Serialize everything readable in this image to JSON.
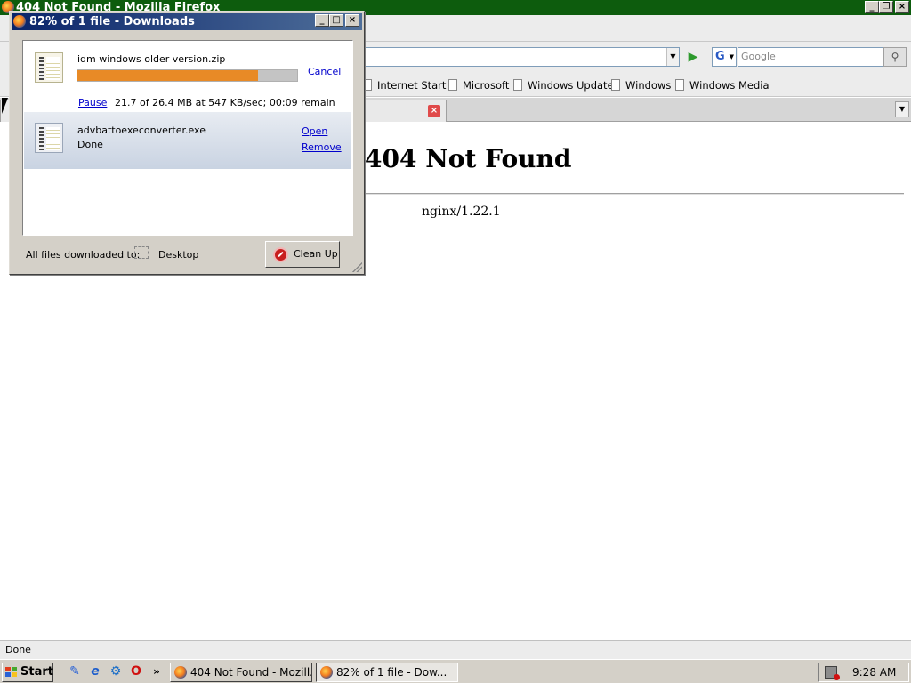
{
  "browser": {
    "window_title": "404 Not Found - Mozilla Firefox",
    "search_engine_letter": "G",
    "search_placeholder": "Google",
    "bookmarks": [
      "Internet Start",
      "Microsoft",
      "Windows Update",
      "Windows",
      "Windows Media"
    ],
    "page_heading": "404 Not Found",
    "page_server": "nginx/1.22.1",
    "status_text": "Done"
  },
  "downloads": {
    "window_title": "82% of 1 file - Downloads",
    "items": [
      {
        "filename": "idm windows older version.zip",
        "action_label": "Cancel",
        "pause_label": "Pause",
        "status": "21.7 of 26.4 MB at 547 KB/sec; 00:09 remain",
        "progress_percent": 82
      },
      {
        "filename": "advbattoexeconverter.exe",
        "status": "Done",
        "open_label": "Open",
        "remove_label": "Remove"
      }
    ],
    "footer_label": "All files downloaded to:",
    "footer_destination": "Desktop",
    "cleanup_label": "Clean Up"
  },
  "taskbar": {
    "start_label": "Start",
    "overflow_label": "»",
    "buttons": [
      "404 Not Found - Mozill...",
      "82% of 1 file - Dow..."
    ],
    "clock": "9:28 AM"
  },
  "colors": {
    "progress_fill": "#e88a26",
    "title_active": "#0a246a",
    "browser_title": "#0d5c0d"
  }
}
